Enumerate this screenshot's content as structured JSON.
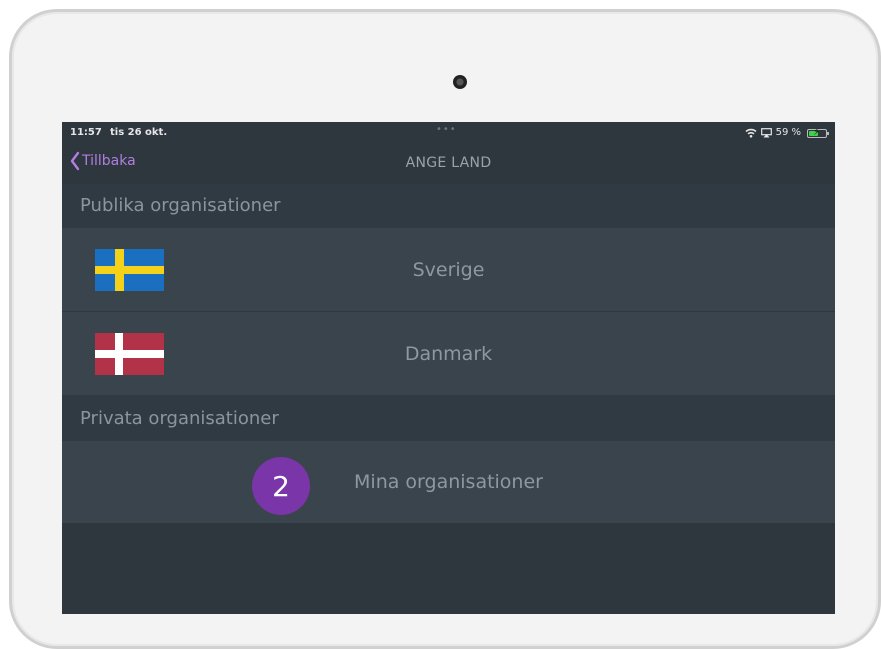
{
  "status_bar": {
    "time": "11:57",
    "date": "tis 26 okt.",
    "dots": "•••",
    "battery_percent": "59 %",
    "battery_level": 0.59
  },
  "navbar": {
    "back_label": "Tillbaka",
    "title": "ANGE LAND"
  },
  "sections": {
    "public_header": "Publika organisationer",
    "private_header": "Privata organisationer"
  },
  "countries": [
    {
      "label": "Sverige",
      "flag": "sweden-flag"
    },
    {
      "label": "Danmark",
      "flag": "denmark-flag"
    }
  ],
  "private_items": [
    {
      "label": "Mina organisationer"
    }
  ],
  "annotation": {
    "step": "2"
  },
  "colors": {
    "accent": "#b07fe0",
    "badge": "#7a35a8",
    "screen_bg": "#2e363e",
    "row_bg": "#3a444c"
  }
}
